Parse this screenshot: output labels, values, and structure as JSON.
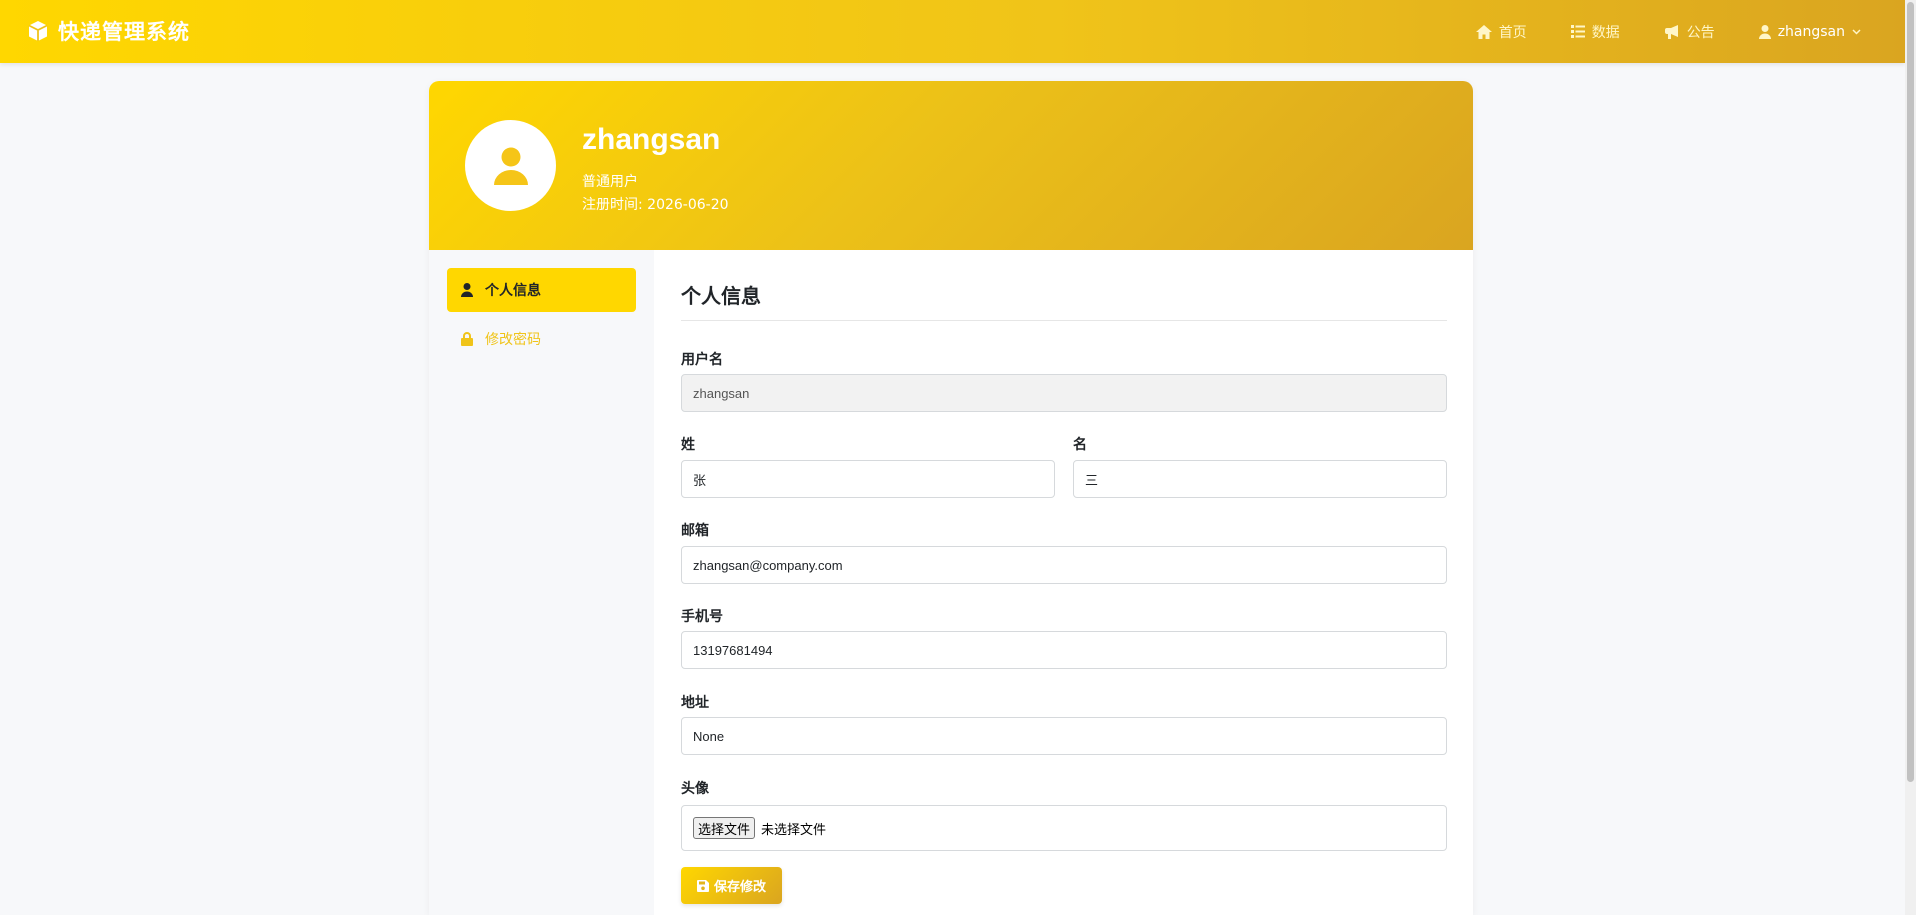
{
  "navbar": {
    "brand": "快递管理系统",
    "brand_icon": "cube-icon",
    "links": [
      {
        "label": "首页",
        "icon": "home-icon"
      },
      {
        "label": "数据",
        "icon": "list-icon"
      },
      {
        "label": "公告",
        "icon": "bullhorn-icon"
      }
    ],
    "user": {
      "label": "zhangsan",
      "icon": "user-icon",
      "caret": "chevron-down-icon"
    }
  },
  "profile": {
    "name": "zhangsan",
    "role": "普通用户",
    "registered": "注册时间: 2026-06-20"
  },
  "sidebar": {
    "items": [
      {
        "label": "个人信息",
        "icon": "user-icon",
        "active": true
      },
      {
        "label": "修改密码",
        "icon": "lock-icon",
        "active": false
      }
    ]
  },
  "form": {
    "title": "个人信息",
    "username": {
      "label": "用户名",
      "value": "zhangsan"
    },
    "last_name": {
      "label": "姓",
      "value": "张"
    },
    "first_name": {
      "label": "名",
      "value": "三"
    },
    "email": {
      "label": "邮箱",
      "value": "zhangsan@company.com"
    },
    "phone": {
      "label": "手机号",
      "value": "13197681494"
    },
    "address": {
      "label": "地址",
      "value": "None"
    },
    "avatar": {
      "label": "头像",
      "button": "选择文件",
      "status": "未选择文件"
    },
    "save_label": "保存修改"
  },
  "colors": {
    "primary": "#ffd700",
    "primary_dark": "#daa520",
    "page_bg": "#f7f8fa"
  }
}
